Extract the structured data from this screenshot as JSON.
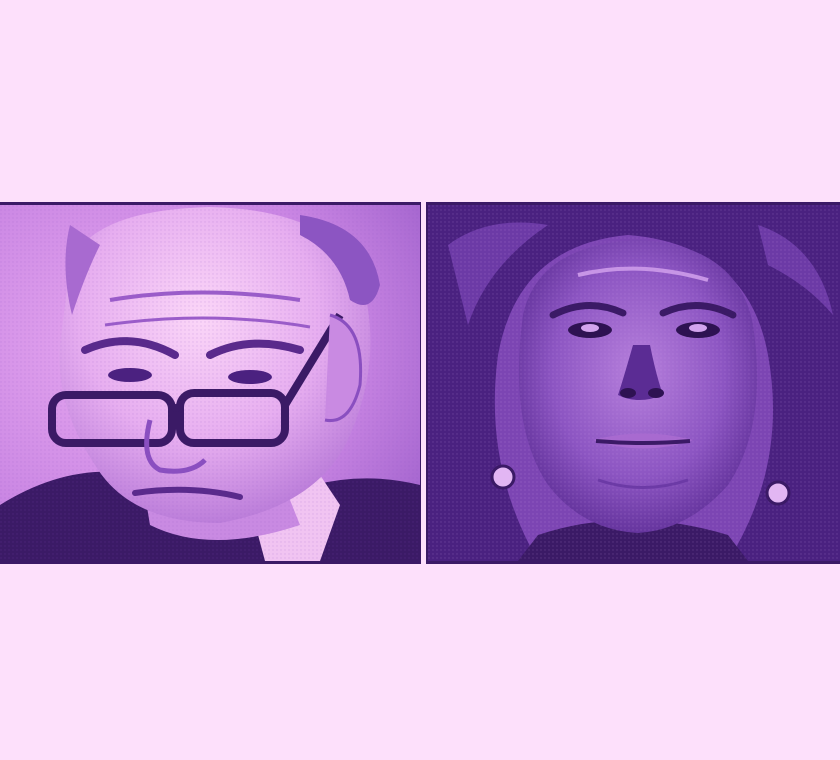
{
  "image": {
    "background_color": "#fde0fb",
    "frame_color": "#3b1a66",
    "palette": {
      "light_pink": "#f6c6f4",
      "lilac": "#d79be8",
      "mid_purple": "#a86ad0",
      "violet": "#7c45b3",
      "dark_purple": "#3b1a66"
    },
    "panels": [
      {
        "subject": "portrait-left",
        "description_icon": "man-with-glasses-portrait"
      },
      {
        "subject": "portrait-right",
        "description_icon": "woman-with-earrings-portrait"
      }
    ]
  }
}
